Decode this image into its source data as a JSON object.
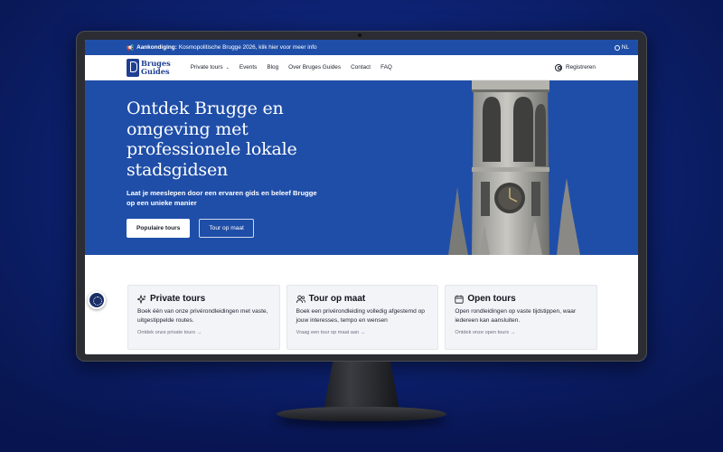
{
  "announcement": {
    "label": "Aankondiging:",
    "text": "Kosmopolitische Brugge 2026, klik hier voor meer info",
    "language": "NL"
  },
  "logo": {
    "line1": "Bruges",
    "line2": "Guides"
  },
  "nav": {
    "items": [
      "Private tours",
      "Events",
      "Blog",
      "Over Bruges Guides",
      "Contact",
      "FAQ"
    ],
    "register": "Registreren"
  },
  "hero": {
    "title": "Ontdek Brugge en omgeving met professionele lokale stadsgidsen",
    "subtitle": "Laat je meeslepen door een ervaren gids en beleef Brugge op een unieke manier",
    "primary_button": "Populaire tours",
    "secondary_button": "Tour op maat"
  },
  "cards": [
    {
      "title": "Private tours",
      "icon": "sparkles-icon",
      "desc": "Boek één van onze privérondleidingen met vaste, uitgestippelde routes.",
      "link": "Ontdek onze private tours →"
    },
    {
      "title": "Tour op maat",
      "icon": "users-icon",
      "desc": "Boek een privérondleiding volledig afgestemd op jouw interesses, tempo en wensen",
      "link": "Vraag een tour op maat aan →"
    },
    {
      "title": "Open tours",
      "icon": "calendar-icon",
      "desc": "Open rondleidingen op vaste tijdstippen, waar iedereen kan aansluiten.",
      "link": "Ontdek onze open tours →"
    }
  ],
  "colors": {
    "brand": "#1f4ea8",
    "logo": "#1f3f93",
    "card_bg": "#f3f4f8"
  }
}
